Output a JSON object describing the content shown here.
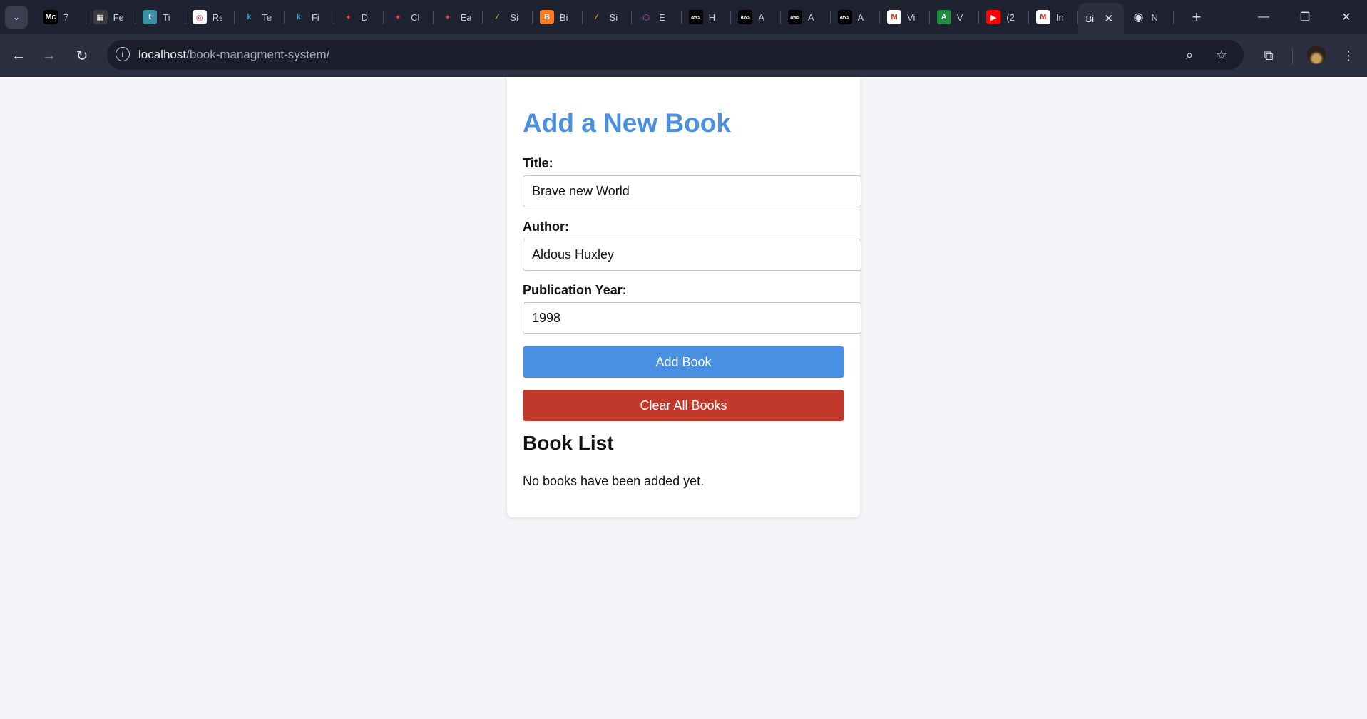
{
  "browser": {
    "tabs": [
      {
        "label": "7",
        "icon": "medium-icon",
        "favicon_text": "Mc",
        "favicon_bg": "#000000"
      },
      {
        "label": "Fe",
        "icon": "keyboard-icon",
        "favicon_text": "▦",
        "favicon_bg": "#3a3a3a"
      },
      {
        "label": "Ti",
        "icon": "t-logo-icon",
        "favicon_text": "t",
        "favicon_bg": "#3d8fa8"
      },
      {
        "label": "Re",
        "icon": "openai-icon",
        "favicon_text": "◎",
        "favicon_bg": "#ffffff"
      },
      {
        "label": "Te",
        "icon": "k-logo-icon",
        "favicon_text": "k",
        "favicon_bg": "#1f2230"
      },
      {
        "label": "Fi",
        "icon": "k-logo-icon",
        "favicon_text": "k",
        "favicon_bg": "#1f2230"
      },
      {
        "label": "D",
        "icon": "maple-leaf-icon",
        "favicon_text": "✦",
        "favicon_bg": "#1f2230"
      },
      {
        "label": "Cl",
        "icon": "maple-leaf-icon",
        "favicon_text": "✦",
        "favicon_bg": "#1f2230"
      },
      {
        "label": "Ea",
        "icon": "maple-leaf-icon",
        "favicon_text": "✦",
        "favicon_bg": "#1f2230"
      },
      {
        "label": "Si",
        "icon": "stripe-logo-icon",
        "favicon_text": "⁄",
        "favicon_bg": "#1f2230"
      },
      {
        "label": "Bi",
        "icon": "xampp-icon",
        "favicon_text": "B",
        "favicon_bg": "#fb7a24"
      },
      {
        "label": "Si",
        "icon": "stripe-logo-icon",
        "favicon_text": "⁄",
        "favicon_bg": "#1f2230"
      },
      {
        "label": "E",
        "icon": "cube-icon",
        "favicon_text": "⬡",
        "favicon_bg": "#1f2230"
      },
      {
        "label": "H",
        "icon": "aws-icon",
        "favicon_text": "aws",
        "favicon_bg": "#000000"
      },
      {
        "label": "A",
        "icon": "aws-icon",
        "favicon_text": "aws",
        "favicon_bg": "#000000"
      },
      {
        "label": "A",
        "icon": "aws-icon",
        "favicon_text": "aws",
        "favicon_bg": "#000000"
      },
      {
        "label": "A",
        "icon": "aws-icon",
        "favicon_text": "aws",
        "favicon_bg": "#000000"
      },
      {
        "label": "Vi",
        "icon": "gmail-icon",
        "favicon_text": "M",
        "favicon_bg": "#ffffff"
      },
      {
        "label": "V",
        "icon": "a-logo-icon",
        "favicon_text": "A",
        "favicon_bg": "#1e8e3e"
      },
      {
        "label": "(2",
        "icon": "youtube-icon",
        "favicon_text": "▶",
        "favicon_bg": "#ff0000"
      },
      {
        "label": "In",
        "icon": "gmail-icon",
        "favicon_text": "M",
        "favicon_bg": "#ffffff"
      }
    ],
    "active_tab": {
      "label": "Bi",
      "close_glyph": "✕"
    },
    "extra_tab": {
      "label": "N",
      "icon": "chrome-icon",
      "favicon_text": "◉"
    },
    "new_tab_glyph": "+",
    "window_controls": {
      "minimize": "—",
      "restore": "❐",
      "close": "✕"
    },
    "nav": {
      "back": "←",
      "forward": "→",
      "reload": "↻"
    },
    "url_host": "localhost",
    "url_path": "/book-managment-system/",
    "info_glyph": "i",
    "zoom_glyph": "⌕",
    "bookmark_glyph": "☆",
    "extensions_glyph": "⧉",
    "menu_glyph": "⋮",
    "colors": {
      "chrome_dark": "#1f2230",
      "toolbar": "#2b2f3f"
    }
  },
  "page": {
    "heading": "Add a New Book",
    "title_label": "Title:",
    "title_value": "Brave new World",
    "author_label": "Author:",
    "author_value": "Aldous Huxley",
    "year_label": "Publication Year:",
    "year_value": "1998",
    "add_button": "Add Book",
    "clear_button": "Clear All Books",
    "list_heading": "Book List",
    "empty_message": "No books have been added yet.",
    "colors": {
      "accent": "#4a90e2",
      "danger": "#c0392b",
      "background": "#f4f5f9"
    }
  }
}
